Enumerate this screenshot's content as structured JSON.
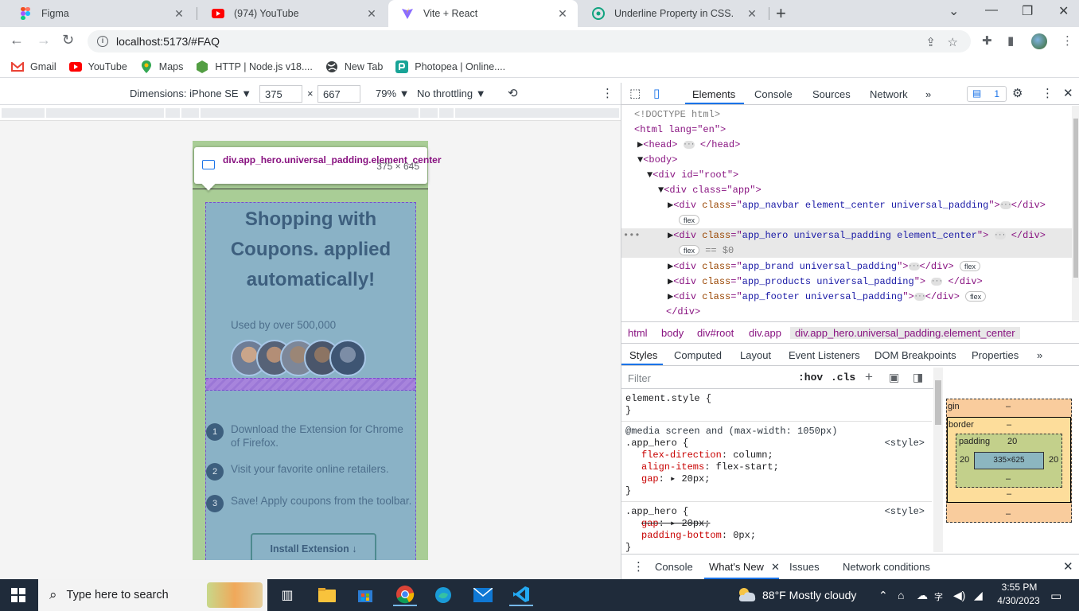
{
  "browser": {
    "tabs": [
      {
        "title": "Figma",
        "icon": "figma-icon"
      },
      {
        "title": "(974) YouTube",
        "icon": "youtube-icon"
      },
      {
        "title": "Vite + React",
        "icon": "vite-icon",
        "active": true
      },
      {
        "title": "Underline Property in CSS.",
        "icon": "chatgpt-icon"
      }
    ],
    "url": "localhost:5173/#FAQ",
    "bookmarks": [
      {
        "label": "Gmail",
        "icon": "gmail-icon"
      },
      {
        "label": "YouTube",
        "icon": "youtube-icon"
      },
      {
        "label": "Maps",
        "icon": "maps-icon"
      },
      {
        "label": "HTTP | Node.js v18....",
        "icon": "nodejs-icon"
      },
      {
        "label": "New Tab",
        "icon": "globe-icon"
      },
      {
        "label": "Photopea | Online....",
        "icon": "photopea-icon"
      }
    ]
  },
  "device_toolbar": {
    "dimensions_label": "Dimensions: iPhone SE",
    "width": "375",
    "times": "×",
    "height": "667",
    "zoom": "79%",
    "throttling": "No throttling"
  },
  "page": {
    "hero_title": "Shopping with Coupons. applied automatically!",
    "used_by": "Used by over 500,000",
    "steps": [
      {
        "num": "1",
        "text": "Download the Extension for Chrome of Firefox."
      },
      {
        "num": "2",
        "text": "Visit your favorite online retailers."
      },
      {
        "num": "3",
        "text": "Save! Apply coupons from the toolbar."
      }
    ],
    "install_label": "Install Extension ↓",
    "tooltip_name": "div.app_hero.universal_padding.element_center",
    "tooltip_size": "375 × 645"
  },
  "devtools": {
    "tabs": [
      "Elements",
      "Console",
      "Sources",
      "Network",
      "»"
    ],
    "issues_count": "1",
    "dom": {
      "doctype": "<!DOCTYPE html>",
      "html_open": "<html lang=\"en\">",
      "head": "head",
      "body": "body",
      "root_div": "div id=\"root\"",
      "app_div": "div class=\"app\"",
      "navbar_cls": "app_navbar element_center universal_padding",
      "hero_cls": "app_hero universal_padding element_center",
      "brand_cls": "app_brand universal_padding",
      "products_cls": "app_products universal_padding",
      "footer_cls": "app_footer universal_padding",
      "flex": "flex",
      "eq0": "== $0",
      "close_div": "</div>"
    },
    "breadcrumbs": [
      "html",
      "body",
      "div#root",
      "div.app",
      "div.app_hero.universal_padding.element_center"
    ],
    "subtabs": [
      "Styles",
      "Computed",
      "Layout",
      "Event Listeners",
      "DOM Breakpoints",
      "Properties",
      "»"
    ],
    "filter_placeholder": "Filter",
    "hov": ":hov",
    "cls": ".cls",
    "styles": {
      "element_style": "element.style {",
      "close_brace": "}",
      "media": "@media screen and (max-width: 1050px)",
      "rule1_selector": ".app_hero {",
      "rule1_source": "<style>",
      "rule1_props": [
        {
          "name": "flex-direction",
          "value": "column;"
        },
        {
          "name": "align-items",
          "value": "flex-start;"
        },
        {
          "name": "gap",
          "value": "▸ 20px;"
        }
      ],
      "rule2_selector": ".app_hero {",
      "rule2_source": "<style>",
      "rule2_props": [
        {
          "name": "gap",
          "value": "▸ 20px;",
          "struck": true
        },
        {
          "name": "padding-bottom",
          "value": "0px;"
        }
      ]
    },
    "box_model": {
      "margin_label": "gin",
      "margin_val": "–",
      "border_label": "border",
      "border_val": "–",
      "padding_label": "padding",
      "padding_top": "20",
      "padding_left": "20",
      "padding_right": "20",
      "padding_bottom": "–",
      "content": "335×625",
      "bottom_border": "–",
      "bottom_margin": "–"
    },
    "drawer_tabs": [
      "Console",
      "What's New",
      "Issues",
      "Network conditions"
    ]
  },
  "taskbar": {
    "search_placeholder": "Type here to search",
    "weather": "88°F  Mostly cloudy",
    "time": "3:55 PM",
    "date": "4/30/2023"
  },
  "colors": {
    "page_bg": "#a9cd96",
    "hero_bg": "#8ab2c6",
    "hero_text": "#3d5f7e",
    "accent": "#1a73e8"
  }
}
